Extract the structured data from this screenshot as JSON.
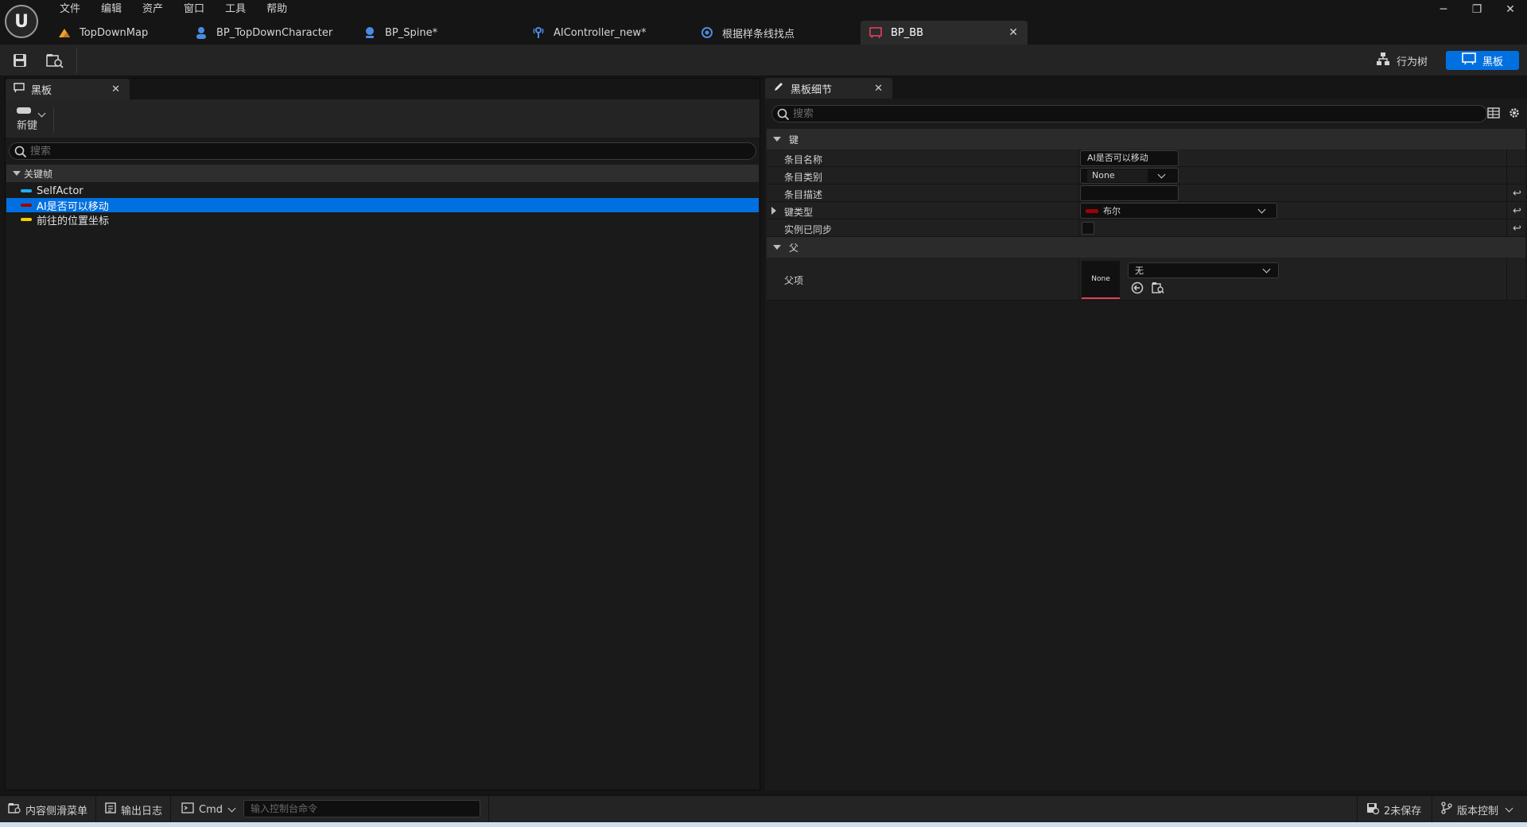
{
  "logo": "U",
  "menu": [
    "文件",
    "编辑",
    "资产",
    "窗口",
    "工具",
    "帮助"
  ],
  "tabs": [
    {
      "label": "TopDownMap",
      "icon": "level-icon",
      "color": "#f0a030"
    },
    {
      "label": "BP_TopDownCharacter",
      "icon": "character-icon",
      "color": "#4a8be0"
    },
    {
      "label": "BP_Spine*",
      "icon": "pawn-icon",
      "color": "#4a8be0"
    },
    {
      "label": "AIController_new*",
      "icon": "controller-icon",
      "color": "#4a8be0"
    },
    {
      "label": "根据样条线找点",
      "icon": "task-icon",
      "color": "#4a8be0"
    },
    {
      "label": "BP_BB",
      "icon": "blackboard-icon",
      "color": "#e0405a",
      "active": true
    }
  ],
  "toolbar": {
    "behavior_tree": "行为树",
    "blackboard": "黑板"
  },
  "left_panel": {
    "tab": "黑板",
    "new_label": "新键",
    "search_placeholder": "搜索",
    "category": "关键帧",
    "keys": [
      {
        "label": "SelfActor",
        "color": "#1fb0f0"
      },
      {
        "label": "AI是否可以移动",
        "color": "#a00000",
        "selected": true
      },
      {
        "label": "前往的位置坐标",
        "color": "#f0d000"
      }
    ]
  },
  "right_panel": {
    "tab": "黑板细节",
    "search_placeholder": "搜索",
    "section_key": "键",
    "section_parent": "父",
    "props": {
      "entry_name_label": "条目名称",
      "entry_name_value": "AI是否可以移动",
      "entry_category_label": "条目类别",
      "entry_category_value": "None",
      "entry_desc_label": "条目描述",
      "entry_desc_value": "",
      "key_type_label": "键类型",
      "key_type_value": "布尔",
      "key_type_color": "#a00000",
      "instance_synced_label": "实例已同步",
      "parent_label": "父项",
      "parent_thumb": "None",
      "parent_value": "无"
    }
  },
  "statusbar": {
    "content_drawer": "内容侧滑菜单",
    "output_log": "输出日志",
    "cmd": "Cmd",
    "console_placeholder": "输入控制台命令",
    "unsaved": "2未保存",
    "source_control": "版本控制"
  }
}
